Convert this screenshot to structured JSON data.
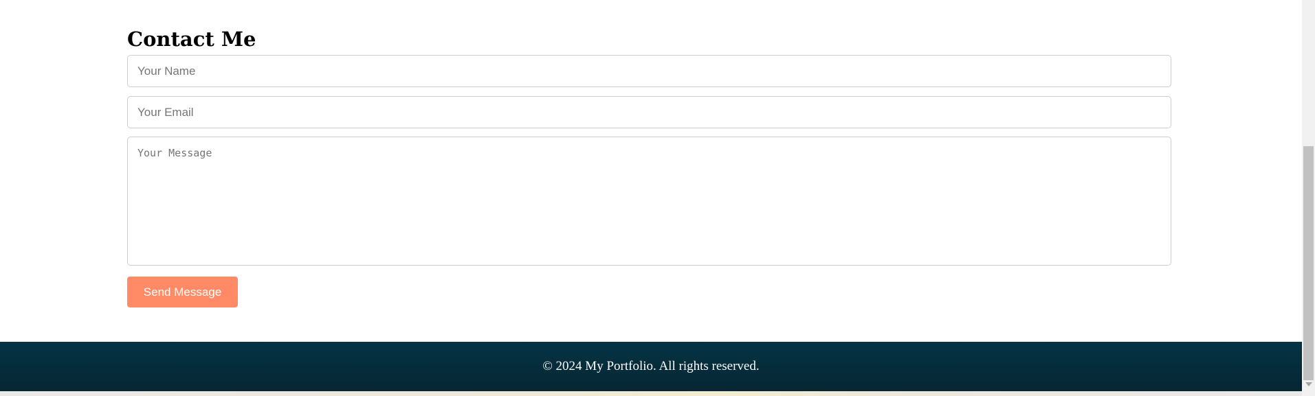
{
  "contact": {
    "title": "Contact Me",
    "name_placeholder": "Your Name",
    "email_placeholder": "Your Email",
    "message_placeholder": "Your Message",
    "send_label": "Send Message"
  },
  "footer": {
    "copyright": "© 2024 My Portfolio. All rights reserved."
  },
  "colors": {
    "button": "#ff8a65",
    "footer_bg": "#053344"
  },
  "scrollbar": {
    "icons": [
      "chevron-down-icon"
    ]
  }
}
